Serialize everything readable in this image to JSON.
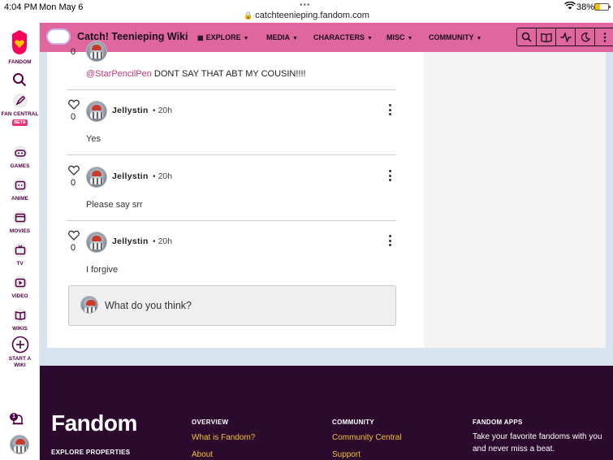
{
  "status_bar": {
    "time": "4:04 PM",
    "date": "Mon May 6",
    "url": "catchteenieping.fandom.com",
    "battery": "38%"
  },
  "rail": {
    "brand": "FANDOM",
    "items": [
      {
        "label": "FAN CENTRAL",
        "badge": "BETA",
        "icon": "rocket-icon"
      },
      {
        "label": "GAMES",
        "icon": "gamepad-icon"
      },
      {
        "label": "ANIME",
        "icon": "anime-icon"
      },
      {
        "label": "MOVIES",
        "icon": "clapperboard-icon"
      },
      {
        "label": "TV",
        "icon": "tv-icon"
      },
      {
        "label": "VIDEO",
        "icon": "play-icon"
      },
      {
        "label": "WIKIS",
        "icon": "book-icon"
      },
      {
        "label": "START A WIKI",
        "icon": "plus-circle-icon"
      }
    ],
    "notification_count": "1"
  },
  "topnav": {
    "wiki_name": "Catch! Teenieping Wiki",
    "items": [
      "EXPLORE",
      "MEDIA",
      "CHARACTERS",
      "MISC",
      "COMMUNITY"
    ],
    "accent": "#e0679d"
  },
  "comments": {
    "fragment": {
      "likes": "0",
      "mention": "@StarPencilPen",
      "text": " DONT SAY THAT ABT MY COUSIN!!!!"
    },
    "replies": [
      {
        "author": "Jellystin",
        "time": "20h",
        "likes": "0",
        "text": "Yes"
      },
      {
        "author": "Jellystin",
        "time": "20h",
        "likes": "0",
        "text": "Please say srr"
      },
      {
        "author": "Jellystin",
        "time": "20h",
        "likes": "0",
        "text": "I forgive"
      }
    ],
    "input_placeholder": "What do you think?"
  },
  "footer": {
    "logo": "Fandom",
    "explore": "EXPLORE PROPERTIES",
    "overview_head": "OVERVIEW",
    "overview_links": [
      "What is Fandom?",
      "About"
    ],
    "community_head": "COMMUNITY",
    "community_links": [
      "Community Central",
      "Support"
    ],
    "apps_head": "FANDOM APPS",
    "apps_text": "Take your favorite fandoms with you and never miss a beat."
  }
}
